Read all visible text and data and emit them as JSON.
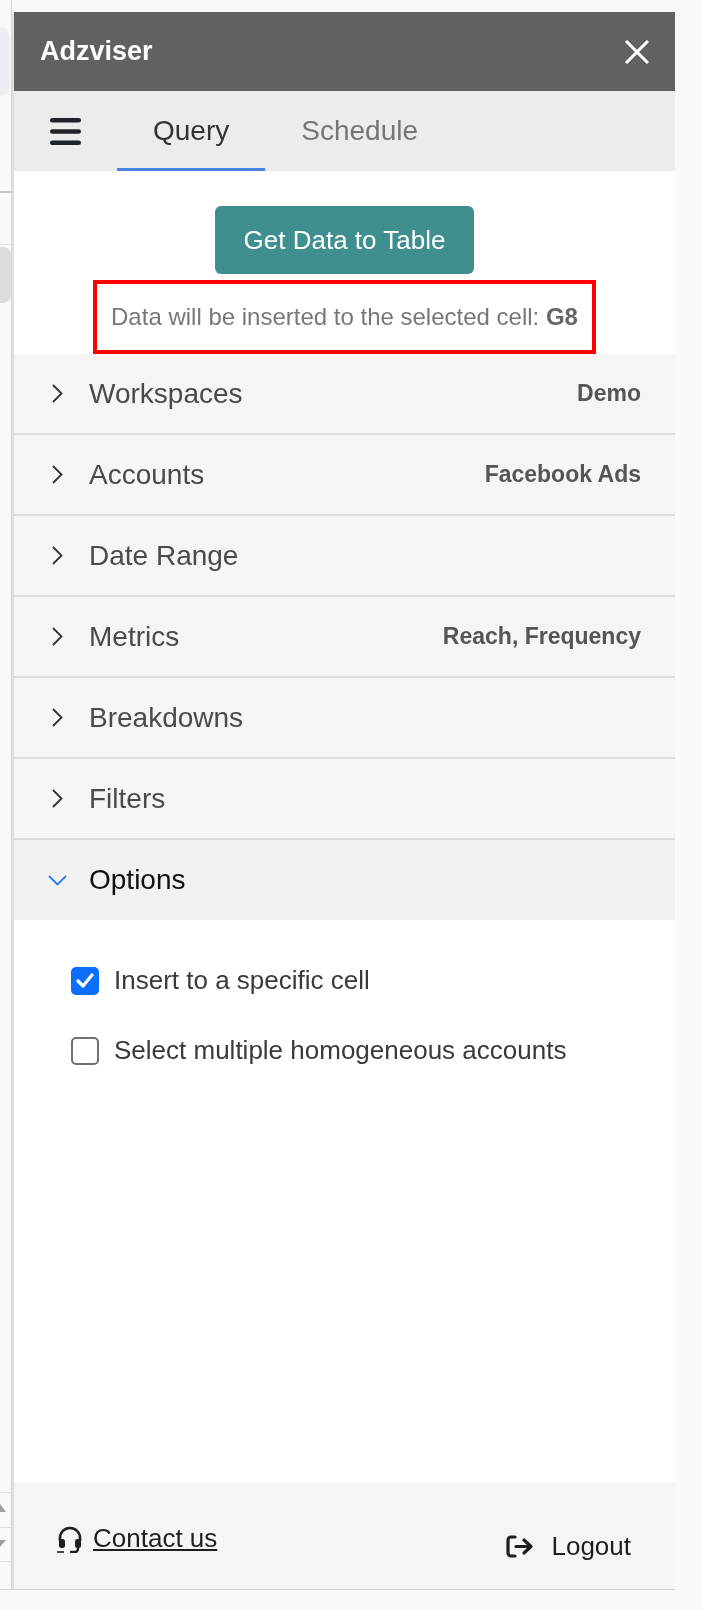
{
  "window": {
    "title": "Adzviser"
  },
  "tabs": [
    {
      "label": "Query",
      "selected": true
    },
    {
      "label": "Schedule",
      "selected": false
    }
  ],
  "action": {
    "button": "Get Data to Table",
    "note": "Data will be inserted to the selected cell: **G8**"
  },
  "sections": [
    {
      "label": "Workspaces",
      "value": "Demo",
      "expanded": false
    },
    {
      "label": "Accounts",
      "value": "Facebook Ads",
      "expanded": false
    },
    {
      "label": "Date Range",
      "expanded": false
    },
    {
      "label": "Metrics",
      "value": "Reach, Frequency",
      "expanded": false
    },
    {
      "label": "Breakdowns",
      "expanded": false
    },
    {
      "label": "Filters",
      "expanded": false
    },
    {
      "label": "Options",
      "expanded": true,
      "options": [
        {
          "label": "Insert to a specific cell",
          "checked": true
        },
        {
          "label": "Select multiple homogeneous accounts",
          "checked": false
        }
      ]
    }
  ],
  "footer": {
    "contact": "Contact us",
    "logout": "Logout"
  }
}
